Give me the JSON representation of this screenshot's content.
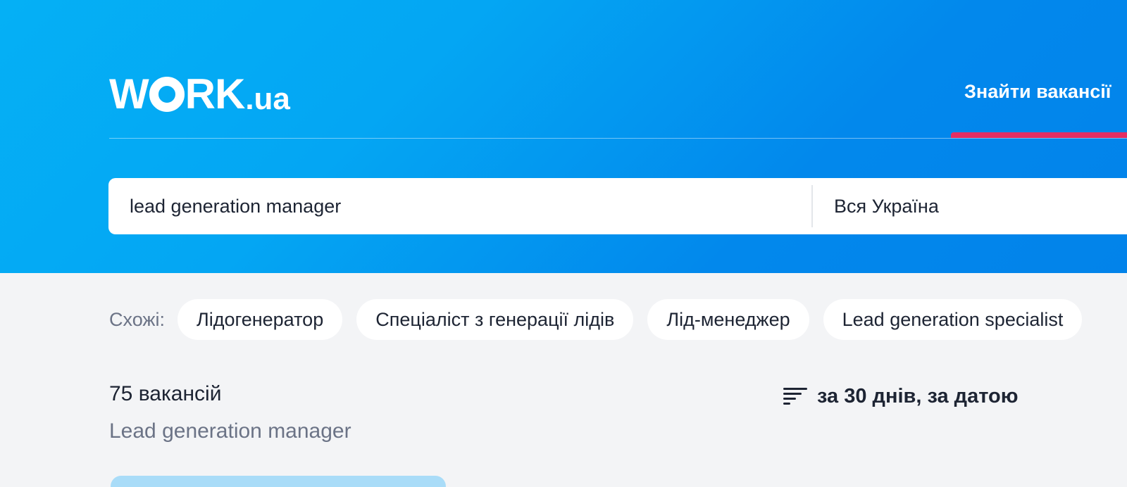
{
  "header": {
    "logo_main": "WORK",
    "logo_suffix": ".ua",
    "nav_find": "Знайти вакансії"
  },
  "search": {
    "query": "lead generation manager",
    "region": "Вся Україна"
  },
  "similar": {
    "label": "Схожі:",
    "chips": [
      "Лідогенератор",
      "Спеціаліст з генерації лідів",
      "Лід-менеджер",
      "Lead generation specialist"
    ]
  },
  "results": {
    "count": "75 вакансій",
    "subtitle": "Lead generation manager",
    "sort_label": "за 30 днів, за датою"
  },
  "colors": {
    "brand_blue": "#04a6f3",
    "accent_pink": "#e52d63"
  },
  "icons": {
    "sort": "sort-icon"
  }
}
